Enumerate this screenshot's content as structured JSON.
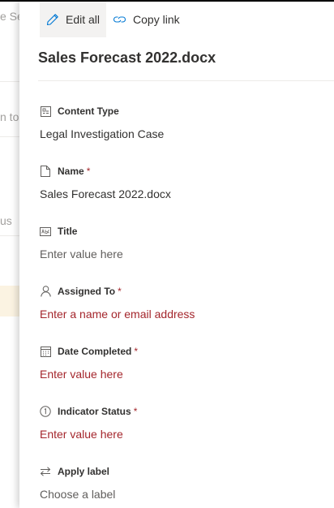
{
  "background": {
    "fragments": [
      "e Se",
      "n to",
      "us"
    ]
  },
  "toolbar": {
    "edit_all_label": "Edit all",
    "copy_link_label": "Copy link"
  },
  "panel": {
    "title": "Sales Forecast 2022.docx"
  },
  "fields": [
    {
      "label": "Content Type",
      "value": "Legal Investigation Case",
      "required": false,
      "state": "value"
    },
    {
      "label": "Name",
      "value": "Sales Forecast 2022.docx",
      "required": true,
      "state": "value"
    },
    {
      "label": "Title",
      "value": "Enter value here",
      "required": false,
      "state": "placeholder"
    },
    {
      "label": "Assigned To",
      "value": "Enter a name or email address",
      "required": true,
      "state": "error"
    },
    {
      "label": "Date Completed",
      "value": "Enter value here",
      "required": true,
      "state": "error"
    },
    {
      "label": "Indicator Status",
      "value": "Enter value here",
      "required": true,
      "state": "error"
    },
    {
      "label": "Apply label",
      "value": "Choose a label",
      "required": false,
      "state": "placeholder"
    }
  ],
  "required_marker": "*",
  "colors": {
    "error": "#a4262c",
    "text": "#323130",
    "placeholder": "#605e5c",
    "accent": "#0078d4"
  },
  "icons": [
    "edit-icon",
    "link-icon",
    "content-type-icon",
    "document-icon",
    "text-field-icon",
    "person-icon",
    "calendar-icon",
    "info-icon",
    "swap-arrows-icon"
  ]
}
